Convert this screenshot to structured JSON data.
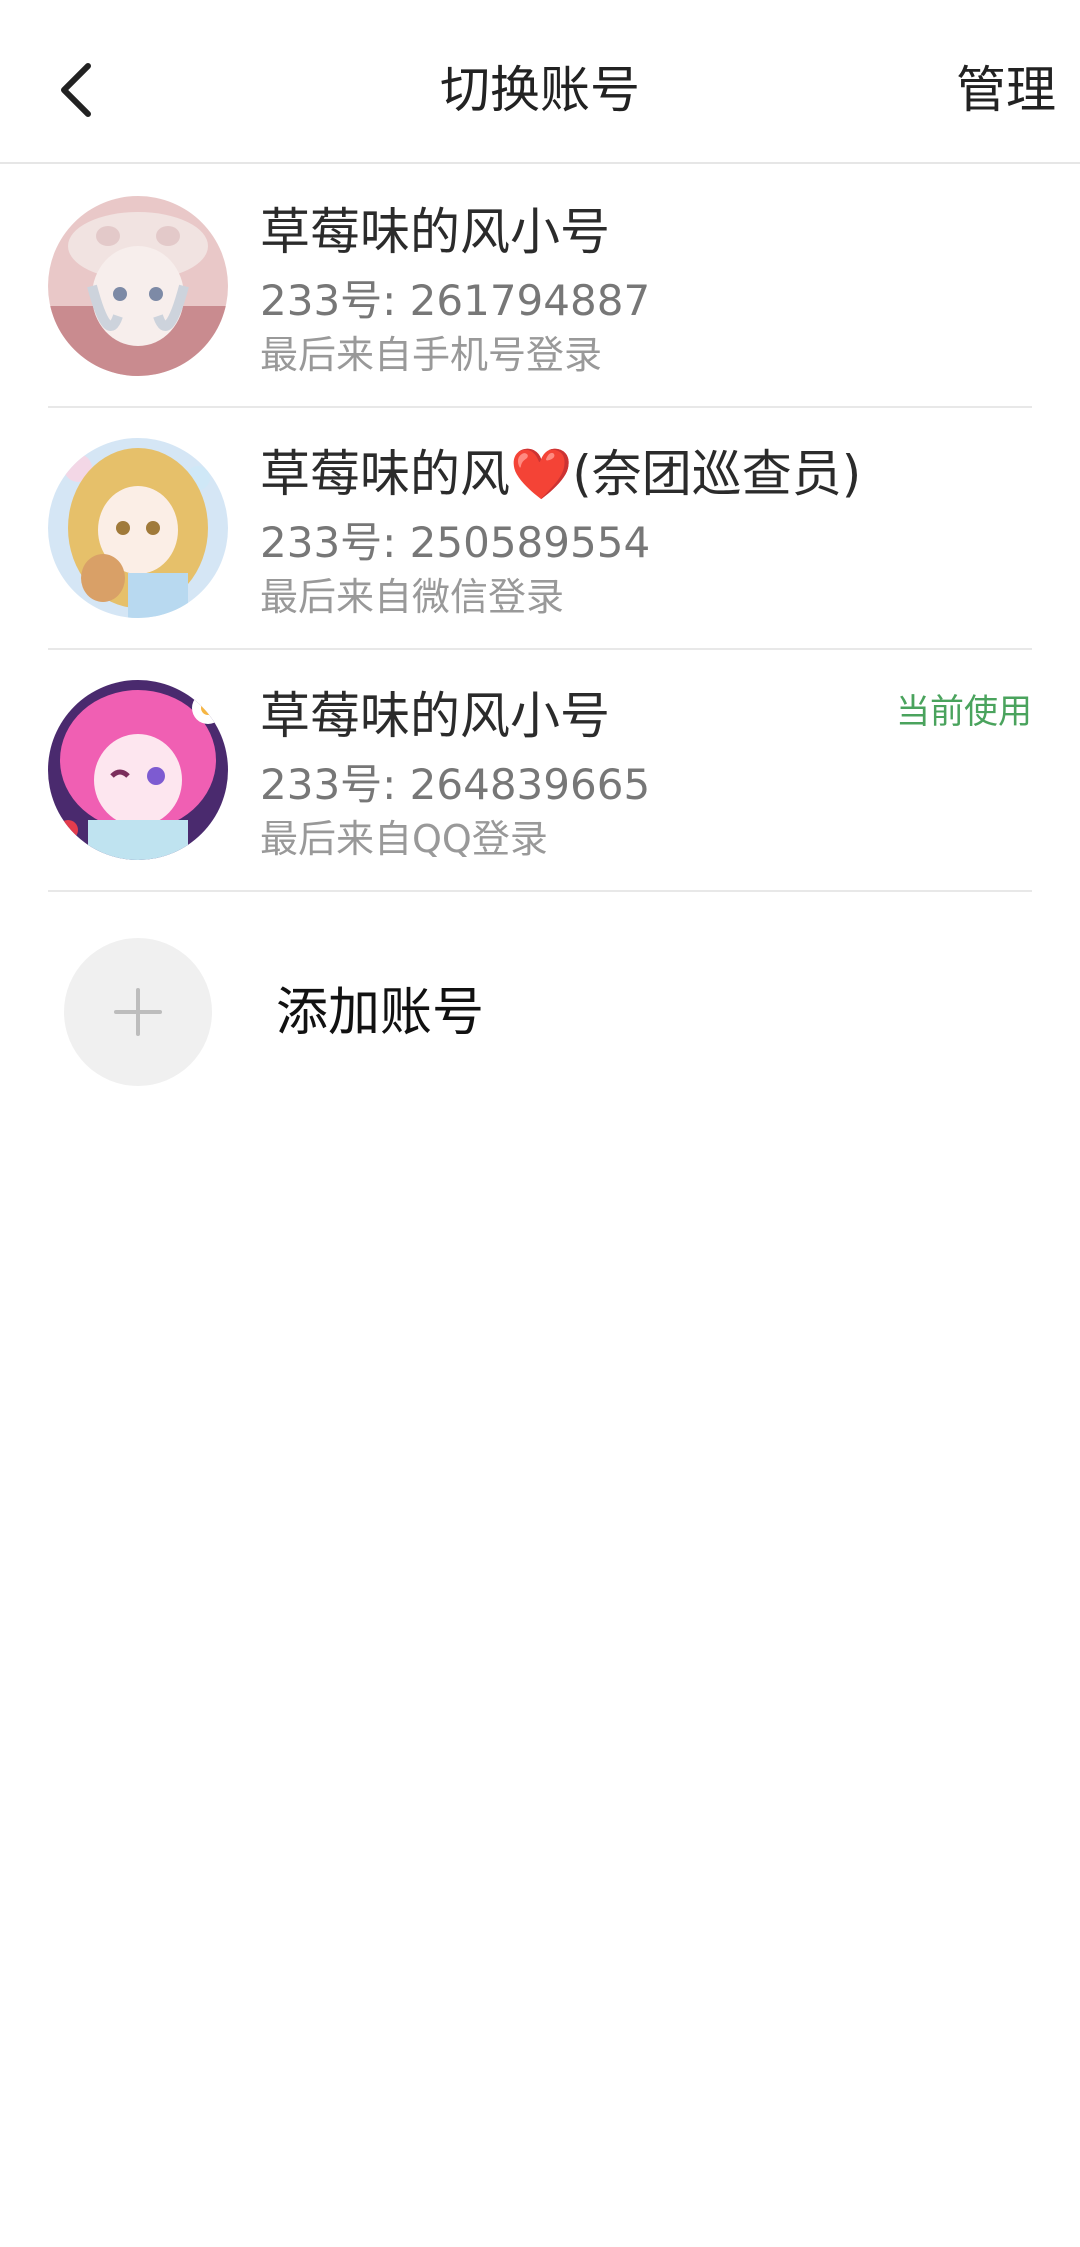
{
  "header": {
    "title": "切换账号",
    "manage_label": "管理",
    "back_icon": "chevron-left-icon"
  },
  "accounts": [
    {
      "name": "草莓味的风小号",
      "id_text": "233号: 261794887",
      "login_text": "最后来自手机号登录",
      "current_label": ""
    },
    {
      "name_prefix": "草莓味的风",
      "name_heart": "❤️",
      "name_suffix": "(奈团巡查员)",
      "id_text": "233号: 250589554",
      "login_text": "最后来自微信登录",
      "current_label": ""
    },
    {
      "name": "草莓味的风小号",
      "id_text": "233号: 264839665",
      "login_text": "最后来自QQ登录",
      "current_label": "当前使用"
    }
  ],
  "add_account": {
    "label": "添加账号",
    "icon": "plus-icon"
  },
  "colors": {
    "current_badge": "#4aa35d",
    "heart": "#e0262b",
    "divider": "#e8e8e8"
  }
}
